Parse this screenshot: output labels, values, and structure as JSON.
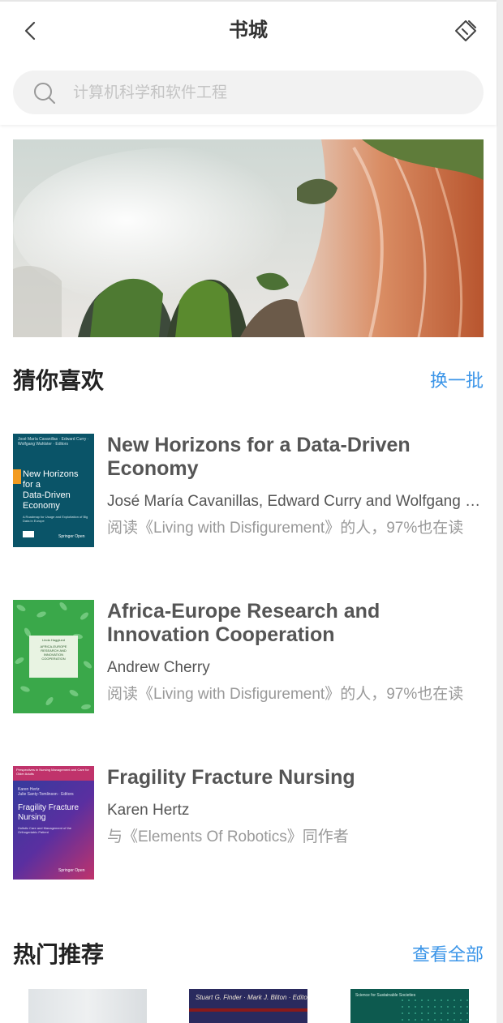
{
  "header": {
    "title": "书城"
  },
  "search": {
    "placeholder": "计算机科学和软件工程"
  },
  "banner": {
    "alt": "waterfall"
  },
  "guess": {
    "title": "猜你喜欢",
    "action": "换一批",
    "books": [
      {
        "title": "New Horizons for a Data-Driven Economy",
        "author": "José María Cavanillas, Edward Curry and Wolfgang Wahlster",
        "reason": "阅读《Living with Disfigurement》的人，97%也在读",
        "cover": {
          "top_text": "José María Cavanillas · Edward Curry · Wolfgang Wahlster · Editors",
          "title_lines": [
            "New Horizons",
            "for a",
            "Data-Driven",
            "Economy"
          ],
          "subtitle": "A Roadmap for Usage and Exploitation of Big Data in Europe",
          "publisher": "Springer Open"
        }
      },
      {
        "title": "Africa-Europe Research and Innovation Cooperation",
        "author": "Andrew Cherry",
        "reason": "阅读《Living with Disfigurement》的人，97%也在读",
        "cover": {
          "top_text": "Linda Hagglund",
          "title_lines": [
            "AFRICA-EUROPE",
            "RESEARCH AND",
            "INNOVATION",
            "COOPERATION"
          ]
        }
      },
      {
        "title": "Fragility Fracture Nursing",
        "author": "Karen Hertz",
        "reason": "与《Elements Of Robotics》同作者",
        "cover": {
          "top_text": "Perspectives in Nursing Management and Care for Older Adults",
          "editors": [
            "Karen Hertz",
            "Julie Santy-Tomlinson · Editors"
          ],
          "title_lines": [
            "Fragility Fracture",
            "Nursing"
          ],
          "subtitle_lines": [
            "Holistic Care and Management of the",
            "Orthogeriatric Patient"
          ],
          "publisher": "Springer Open"
        }
      }
    ]
  },
  "hot": {
    "title": "热门推荐",
    "action": "查看全部",
    "covers": [
      {
        "text": ""
      },
      {
        "text": "Stuart G. Finder · Mark J. Bliton · Editors"
      },
      {
        "text": "Science for Sustainable Societies"
      }
    ]
  },
  "colors": {
    "accent": "#3b95e8",
    "cover1": "#0a5468",
    "cover2": "#3aa84a",
    "cover3": "#3b3aa0"
  }
}
